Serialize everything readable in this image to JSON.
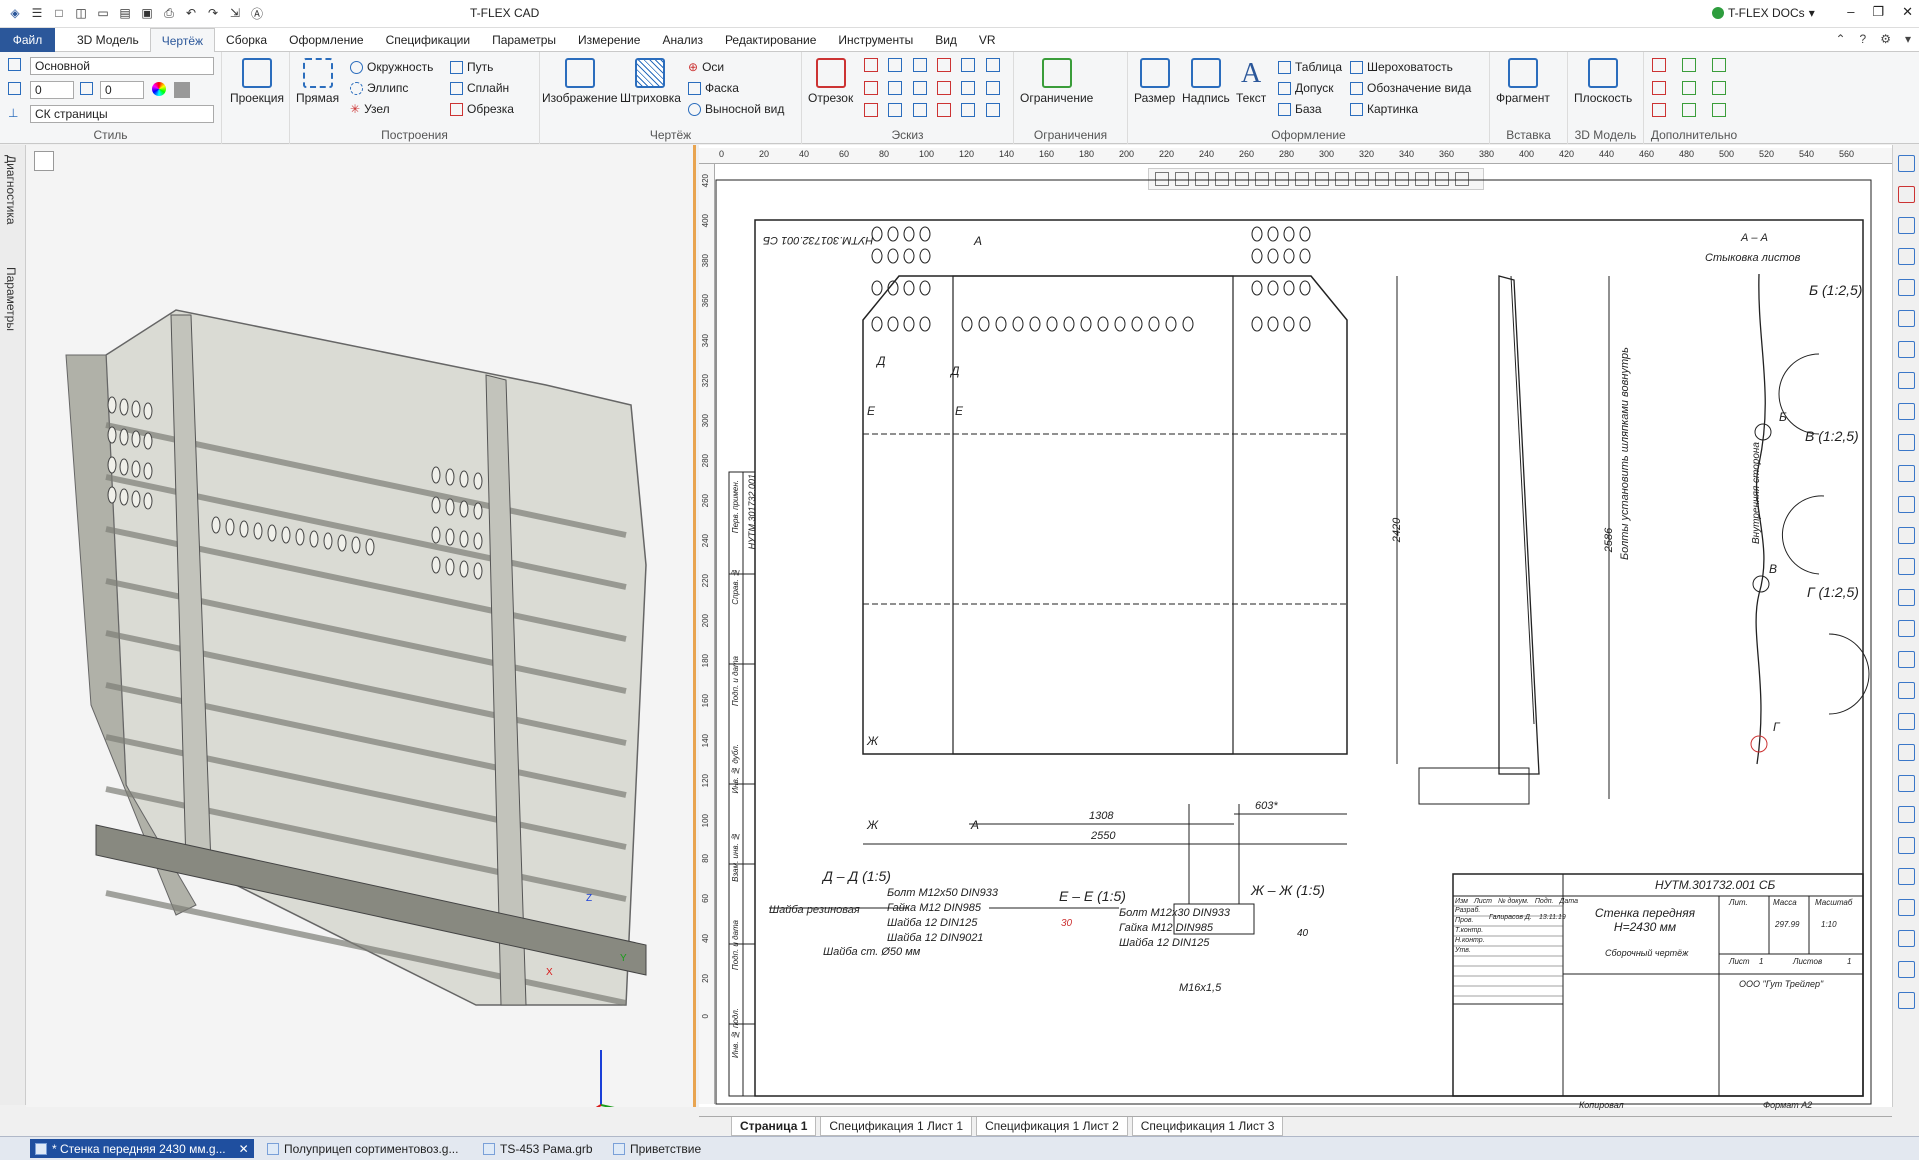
{
  "window": {
    "title": "T-FLEX CAD",
    "docs_label": "T-FLEX DOCs"
  },
  "menu": {
    "file": "Файл",
    "tabs": [
      "3D Модель",
      "Чертёж",
      "Сборка",
      "Оформление",
      "Спецификации",
      "Параметры",
      "Измерение",
      "Анализ",
      "Редактирование",
      "Инструменты",
      "Вид",
      "VR"
    ],
    "active_tab": "Чертёж"
  },
  "ribbon": {
    "style": {
      "layer": "Основной",
      "val1": "0",
      "val2": "0",
      "cs": "СК страницы",
      "label": "Стиль"
    },
    "projection": "Проекция",
    "build": {
      "label": "Построения",
      "line": "Прямая",
      "circle": "Окружность",
      "ellipse": "Эллипс",
      "node": "Узел",
      "path": "Путь",
      "spline": "Сплайн",
      "trim": "Обрезка"
    },
    "drawing": {
      "label": "Чертёж",
      "image": "Изображение",
      "hatch": "Штриховка",
      "axes": "Оси",
      "chamfer": "Фаска",
      "detail": "Выносной вид"
    },
    "sketch": {
      "label": "Эскиз",
      "segment": "Отрезок"
    },
    "constraints": {
      "label": "Ограничения",
      "button": "Ограничение"
    },
    "design": {
      "label": "Оформление",
      "size": "Размер",
      "caption": "Надпись",
      "text": "Текст",
      "table": "Таблица",
      "tolerance": "Допуск",
      "base": "База",
      "roughness": "Шероховатость",
      "view_label": "Обозначение вида",
      "picture": "Картинка"
    },
    "insert": {
      "label": "Вставка",
      "fragment": "Фрагмент"
    },
    "model3d": {
      "label": "3D Модель",
      "plane": "Плоскость"
    },
    "extra": {
      "label": "Дополнительно"
    }
  },
  "left_tabs": [
    "Диагностика",
    "Параметры"
  ],
  "drawing": {
    "title_code": "НУТМ.301732.001 СБ",
    "title_code_mirror": "НУТМ.301732.001 СБ",
    "title_name": "Стенка передняя H=2430 мм",
    "title_sub": "Сборочный чертёж",
    "company": "ООО \"Гут Трейлер\"",
    "mass": "297.99",
    "scale": "1:10",
    "sheet": "1",
    "format": "Формат  А2",
    "copied": "Копировал",
    "section_aa": "А – А",
    "joint_label": "Стыковка листов",
    "view_b": "Б (1:2,5)",
    "view_v": "В (1:2,5)",
    "view_g": "Г (1:2,5)",
    "sec_dd": "Д – Д (1:5)",
    "sec_ee": "Е – Е (1:5)",
    "sec_zz": "Ж – Ж (1:5)",
    "dd_notes": [
      "Болт М12х50 DIN933",
      "Гайка  М12 DIN985",
      "Шайба  12 DIN125",
      "Шайба  12 DIN9021"
    ],
    "dd_rubber": "Шайба резиновая",
    "dd_steel": "Шайба ст. Ø50 мм",
    "ee_notes": [
      "Болт М12х30 DIN933",
      "Гайка  М12 DIN985",
      "Шайба  12 DIN125"
    ],
    "ee_dim": "30",
    "zz_dim": "40",
    "zz_thread": "М16х1,5",
    "dim_1308": "1308",
    "dim_2550": "2550",
    "dim_603": "603*",
    "dim_2420": "2420",
    "dim_2586": "2586",
    "note_vertical": "Болты установить шляпками вовнутрь",
    "inner_side": "Внутренняя сторона",
    "letter_a": "А",
    "letter_d": "Д",
    "letter_e": "Е",
    "letter_zh": "Ж",
    "letter_b": "Б",
    "letter_v": "В",
    "letter_g": "Г",
    "tb_rows": [
      "Изм",
      "Лист",
      "№ докум.",
      "Подп.",
      "Дата"
    ],
    "tb_roles": [
      "Разраб.",
      "Пров.",
      "Т.контр.",
      "Н.контр.",
      "Утв."
    ],
    "tb_author": "Галирасов Д.",
    "tb_date": "13.11.19",
    "tb_col_lit": "Лит.",
    "tb_col_mass": "Масса",
    "tb_col_scale": "Масштаб",
    "tb_col_sheet": "Лист",
    "tb_col_sheets": "Листов",
    "tb_sheets": "1",
    "side_labels": [
      "Перв. примен.",
      "Справ. №",
      "Подп. и дата",
      "Инв. № дубл.",
      "Взам. инв. №",
      "Подп. и дата",
      "Инв. № подл."
    ],
    "side_code": "НУТМ.301732.001"
  },
  "sheet_tabs": [
    "Страница 1",
    "Спецификация 1 Лист 1",
    "Спецификация 1 Лист 2",
    "Спецификация 1 Лист 3"
  ],
  "ruler_top": [
    "0",
    "20",
    "40",
    "60",
    "80",
    "100",
    "120",
    "140",
    "160",
    "180",
    "200",
    "220",
    "240",
    "260",
    "280",
    "300",
    "320",
    "340",
    "360",
    "380",
    "400",
    "420",
    "440",
    "460",
    "480",
    "500",
    "520",
    "540",
    "560"
  ],
  "ruler_left": [
    "420",
    "400",
    "380",
    "360",
    "340",
    "320",
    "300",
    "280",
    "260",
    "240",
    "220",
    "200",
    "180",
    "160",
    "140",
    "120",
    "100",
    "80",
    "60",
    "40",
    "20",
    "0"
  ],
  "axes3d": {
    "x": "X",
    "y": "Y",
    "z": "Z"
  },
  "taskbar": [
    "* Стенка передняя 2430 мм.g...",
    "Полуприцеп сортиментовоз.g...",
    "TS-453 Рама.grb",
    "Приветствие"
  ],
  "colors": {
    "accent": "#2b579a",
    "viewport_border": "#e8a450",
    "docs_green": "#2e9d3e"
  }
}
